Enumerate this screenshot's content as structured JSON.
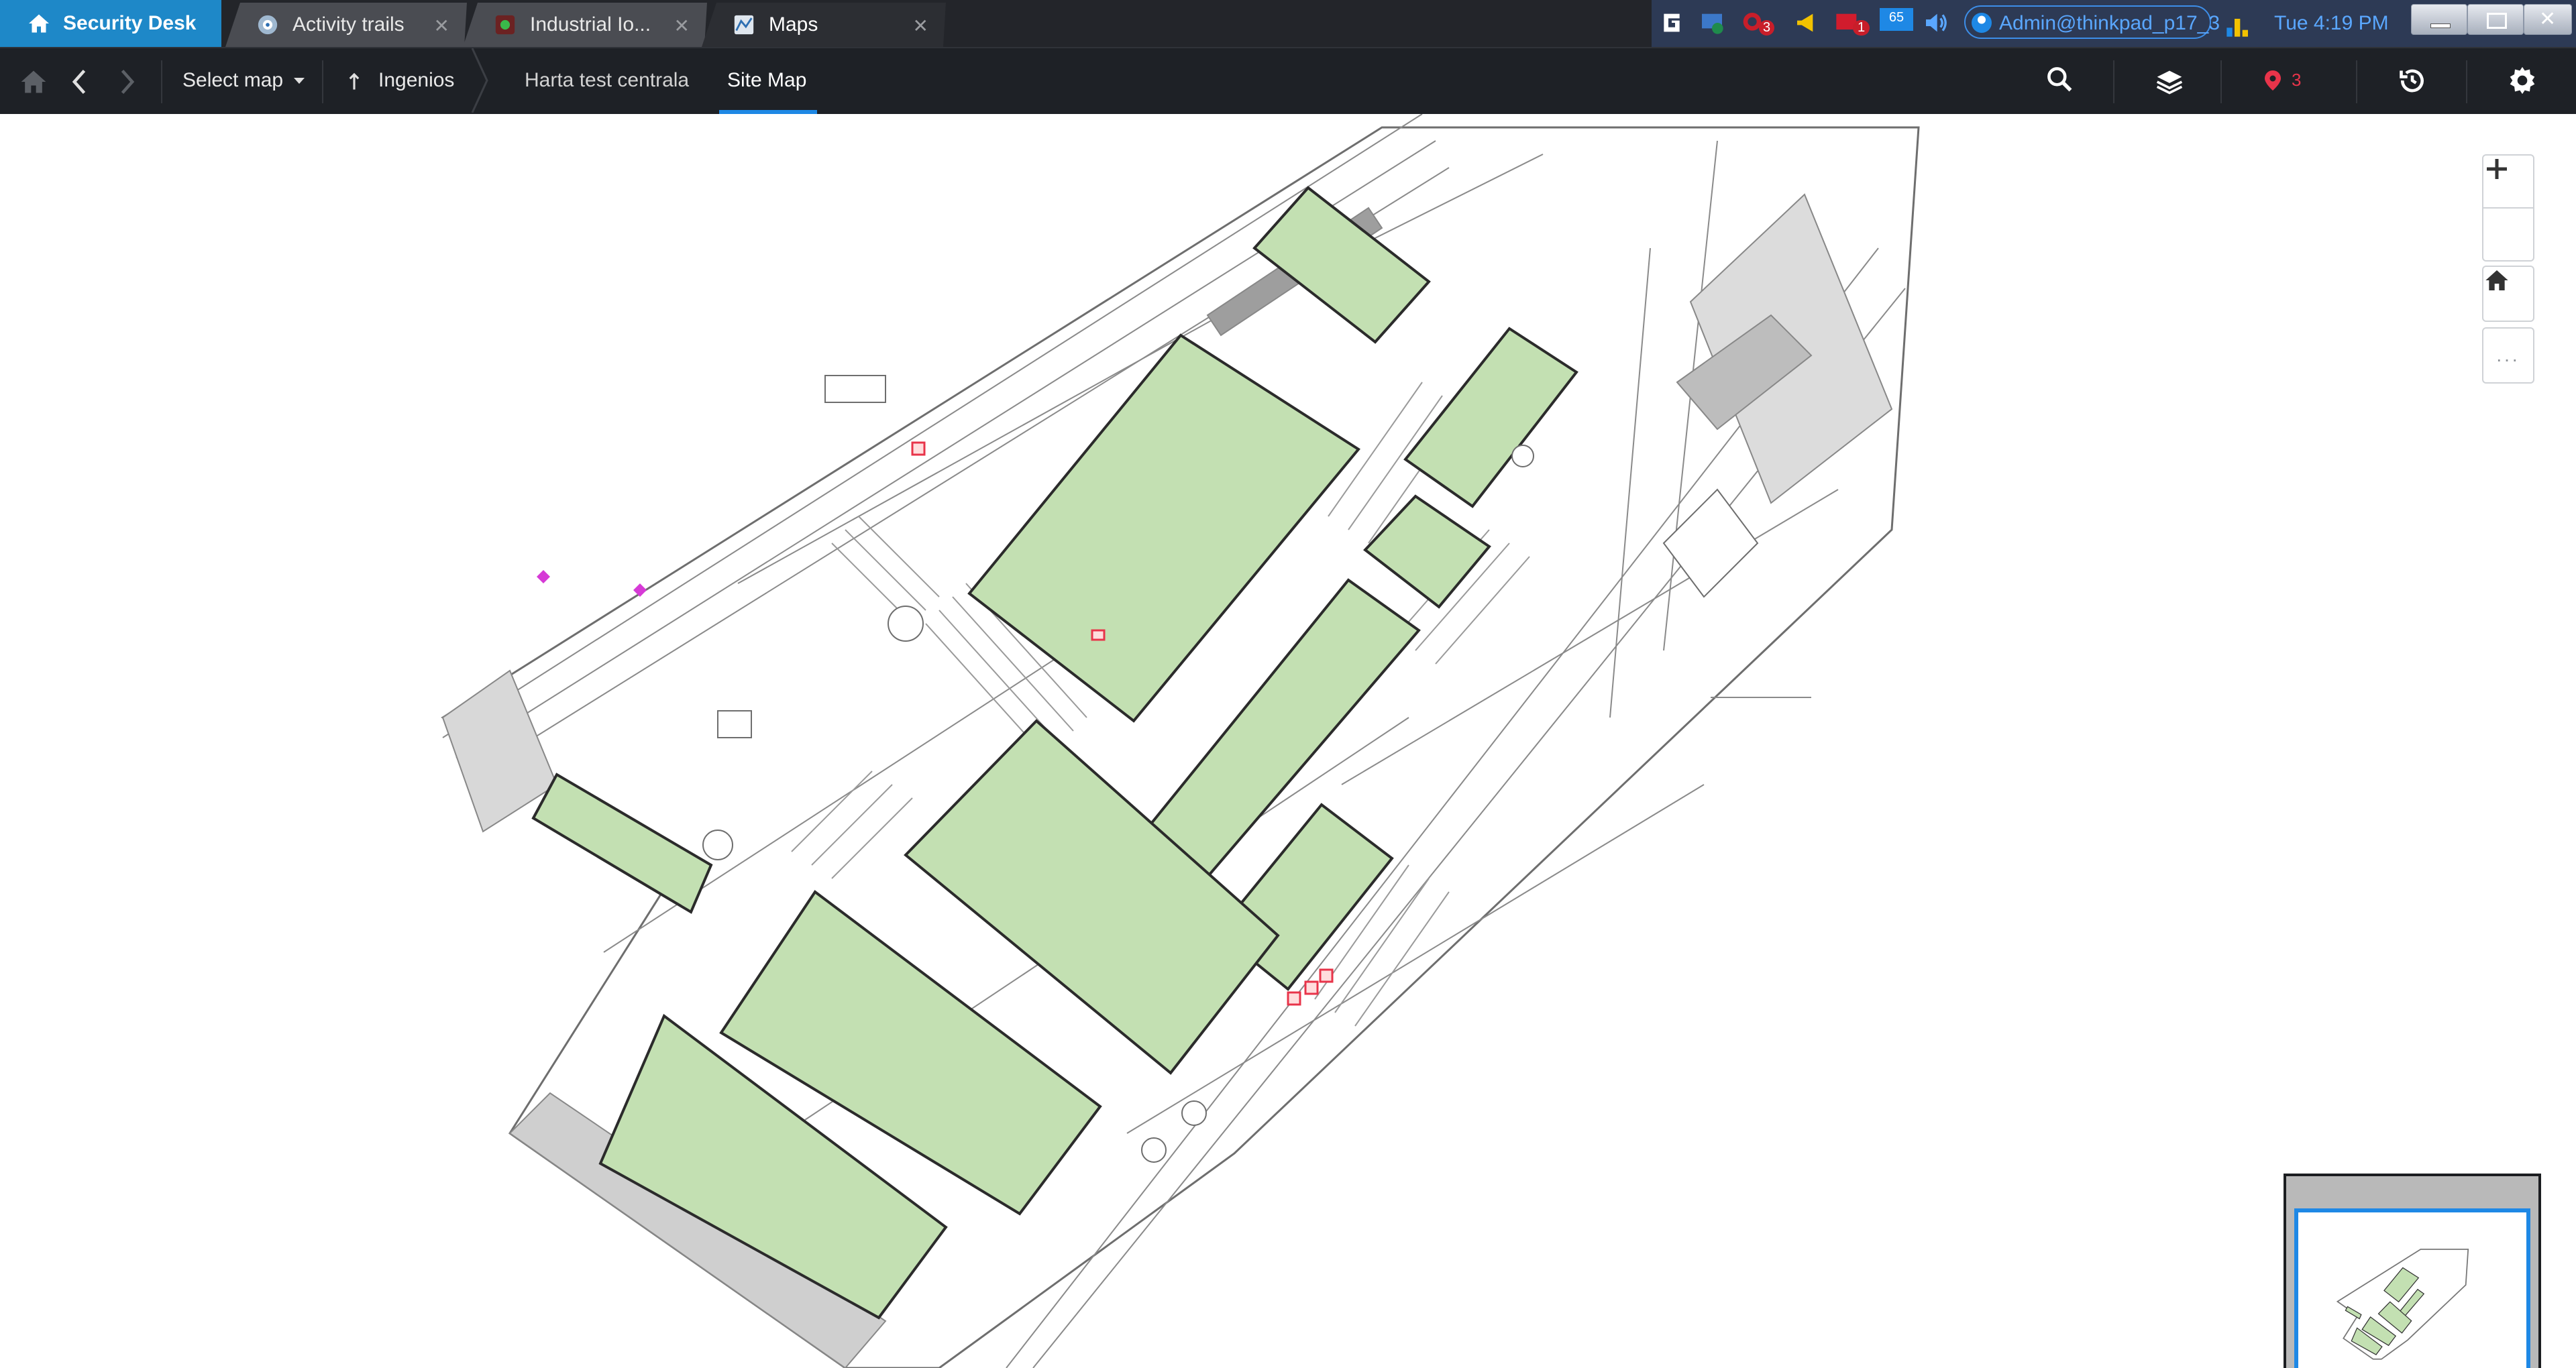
{
  "app": {
    "title": "Security Desk"
  },
  "tabs": [
    {
      "label": "Activity trails",
      "icon": "activity-trails-icon"
    },
    {
      "label": "Industrial Io...",
      "icon": "industrial-iot-icon"
    },
    {
      "label": "Maps",
      "icon": "maps-icon",
      "active": true
    }
  ],
  "tray": {
    "alarm_badge": "3",
    "notification_badge": "1",
    "monitor_badge": "65",
    "user": "Admin@thinkpad_p17_3",
    "clock": "Tue 4:19 PM"
  },
  "toolbar": {
    "select_map_label": "Select map",
    "parent_label": "Ingenios",
    "breadcrumb": [
      "Harta test centrala",
      "Site Map"
    ],
    "alarm_count": "3"
  },
  "map_controls": {
    "more_label": "..."
  },
  "colors": {
    "app_tab": "#1e88c8",
    "accent": "#1e88e5",
    "building_fill": "#c3e0b2",
    "alarm_red": "#e8344a",
    "toolbar_bg": "#1e2126"
  }
}
